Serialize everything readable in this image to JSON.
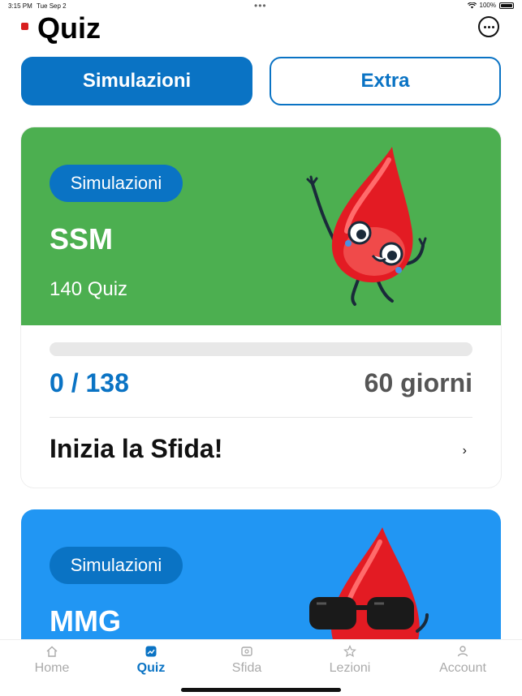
{
  "status_bar": {
    "time": "3:15 PM",
    "date": "Tue Sep 2",
    "battery": "100%"
  },
  "header": {
    "title": "Quiz"
  },
  "segments": {
    "active": "Simulazioni",
    "inactive": "Extra"
  },
  "cards": [
    {
      "badge": "Simulazioni",
      "title": "SSM",
      "subtitle": "140 Quiz",
      "progress_text": "0 / 138",
      "progress_fraction": 0,
      "days": "60 giorni",
      "cta": "Inizia la Sfida!",
      "color": "#4caf50"
    },
    {
      "badge": "Simulazioni",
      "title": "MMG",
      "color": "#2196f3"
    }
  ],
  "tab_bar": [
    {
      "label": "Home",
      "icon": "home-icon"
    },
    {
      "label": "Quiz",
      "icon": "quiz-icon",
      "active": true
    },
    {
      "label": "Sfida",
      "icon": "challenge-icon"
    },
    {
      "label": "Lezioni",
      "icon": "star-icon"
    },
    {
      "label": "Account",
      "icon": "account-icon"
    }
  ],
  "colors": {
    "accent": "#0a73c4",
    "ssm_card": "#4caf50",
    "mmg_card": "#2196f3"
  }
}
